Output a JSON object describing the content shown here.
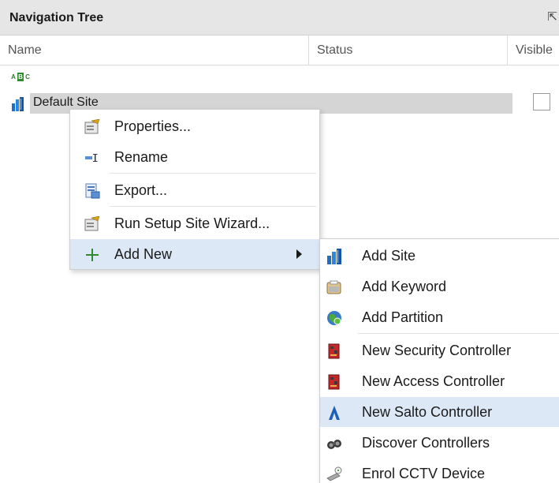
{
  "panel": {
    "title": "Navigation Tree",
    "pin_glyph": "⇱"
  },
  "columns": {
    "name": "Name",
    "status": "Status",
    "visible": "Visible"
  },
  "sort_icon": {
    "letters": [
      "A",
      "B",
      "C"
    ]
  },
  "tree": {
    "site_label": "Default Site"
  },
  "context_menu": {
    "items": [
      {
        "label": "Properties...",
        "icon": "properties-icon"
      },
      {
        "label": "Rename",
        "icon": "rename-icon"
      },
      {
        "label": "Export...",
        "icon": "export-icon"
      },
      {
        "label": "Run Setup Site Wizard...",
        "icon": "wizard-icon"
      },
      {
        "label": "Add New",
        "icon": "plus-icon",
        "has_submenu": true,
        "highlighted": true
      }
    ]
  },
  "submenu": {
    "items": [
      {
        "label": "Add Site",
        "icon": "site-icon"
      },
      {
        "label": "Add Keyword",
        "icon": "keyword-icon"
      },
      {
        "label": "Add Partition",
        "icon": "partition-icon"
      },
      {
        "label": "New Security Controller",
        "icon": "controller-icon"
      },
      {
        "label": "New Access Controller",
        "icon": "controller-icon"
      },
      {
        "label": "New Salto Controller",
        "icon": "salto-icon",
        "highlighted": true
      },
      {
        "label": "Discover Controllers",
        "icon": "binoculars-icon"
      },
      {
        "label": "Enrol CCTV Device",
        "icon": "cctv-icon"
      }
    ]
  },
  "colors": {
    "highlight": "#dde8f6",
    "header_bg": "#e6e6e6",
    "selected_row": "#d5d5d5",
    "plus_green": "#2e8b2e"
  }
}
